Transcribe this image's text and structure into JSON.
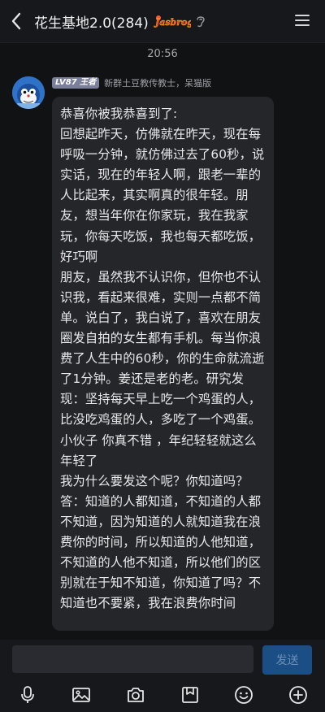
{
  "header": {
    "back_icon": "chevron-left-icon",
    "title": "花生基地2.0(284)",
    "fancy_badge_text": "Jasbrog",
    "ear_icon": "ear-icon",
    "menu_icon": "hamburger-menu-icon"
  },
  "chat": {
    "timestamp": "20:56",
    "message": {
      "avatar": "avatar-blue-character",
      "level": "LV87 王者",
      "sender": "新群土豆教传教士，呆猫版",
      "text": "恭喜你被我恭喜到了:\n回想起昨天，仿佛就在昨天，现在每呼吸一分钟，就仿佛过去了60秒，说实话，现在的年轻人啊，跟老一辈的人比起来，其实啊真的很年轻。朋友，想当年你在你家玩，我在我家玩，你每天吃饭，我也每天都吃饭，好巧啊\n朋友，虽然我不认识你，但你也不认识我，看起来很难，实则一点都不简单。说白了，我白说了，喜欢在朋友圈发自拍的女生都有手机。每当你浪费了人生中的60秒，你的生命就流逝了1分钟。姜还是老的老。研究发现：坚持每天早上吃一个鸡蛋的人，比没吃鸡蛋的人，多吃了一个鸡蛋。小伙子 你真不错 ，年纪轻轻就这么年轻了\n我为什么要发这个呢？你知道吗？答：知道的人都知道，不知道的人都不知道，因为知道的人就知道我在浪费你的时间，所以知道的人他知道，不知道的人他不知道，所以他们的区别就在于知不知道，你知道了吗？不知道也不要紧，我在浪费你时间"
    }
  },
  "input": {
    "value": "",
    "placeholder": "",
    "send_label": "发送"
  },
  "toolbar": {
    "icons": [
      "microphone-icon",
      "image-icon",
      "camera-icon",
      "bookmark-icon",
      "emoji-icon",
      "plus-icon"
    ]
  },
  "colors": {
    "background": "#111214",
    "bubble": "#25262a",
    "send_button": "#1b4e84"
  }
}
